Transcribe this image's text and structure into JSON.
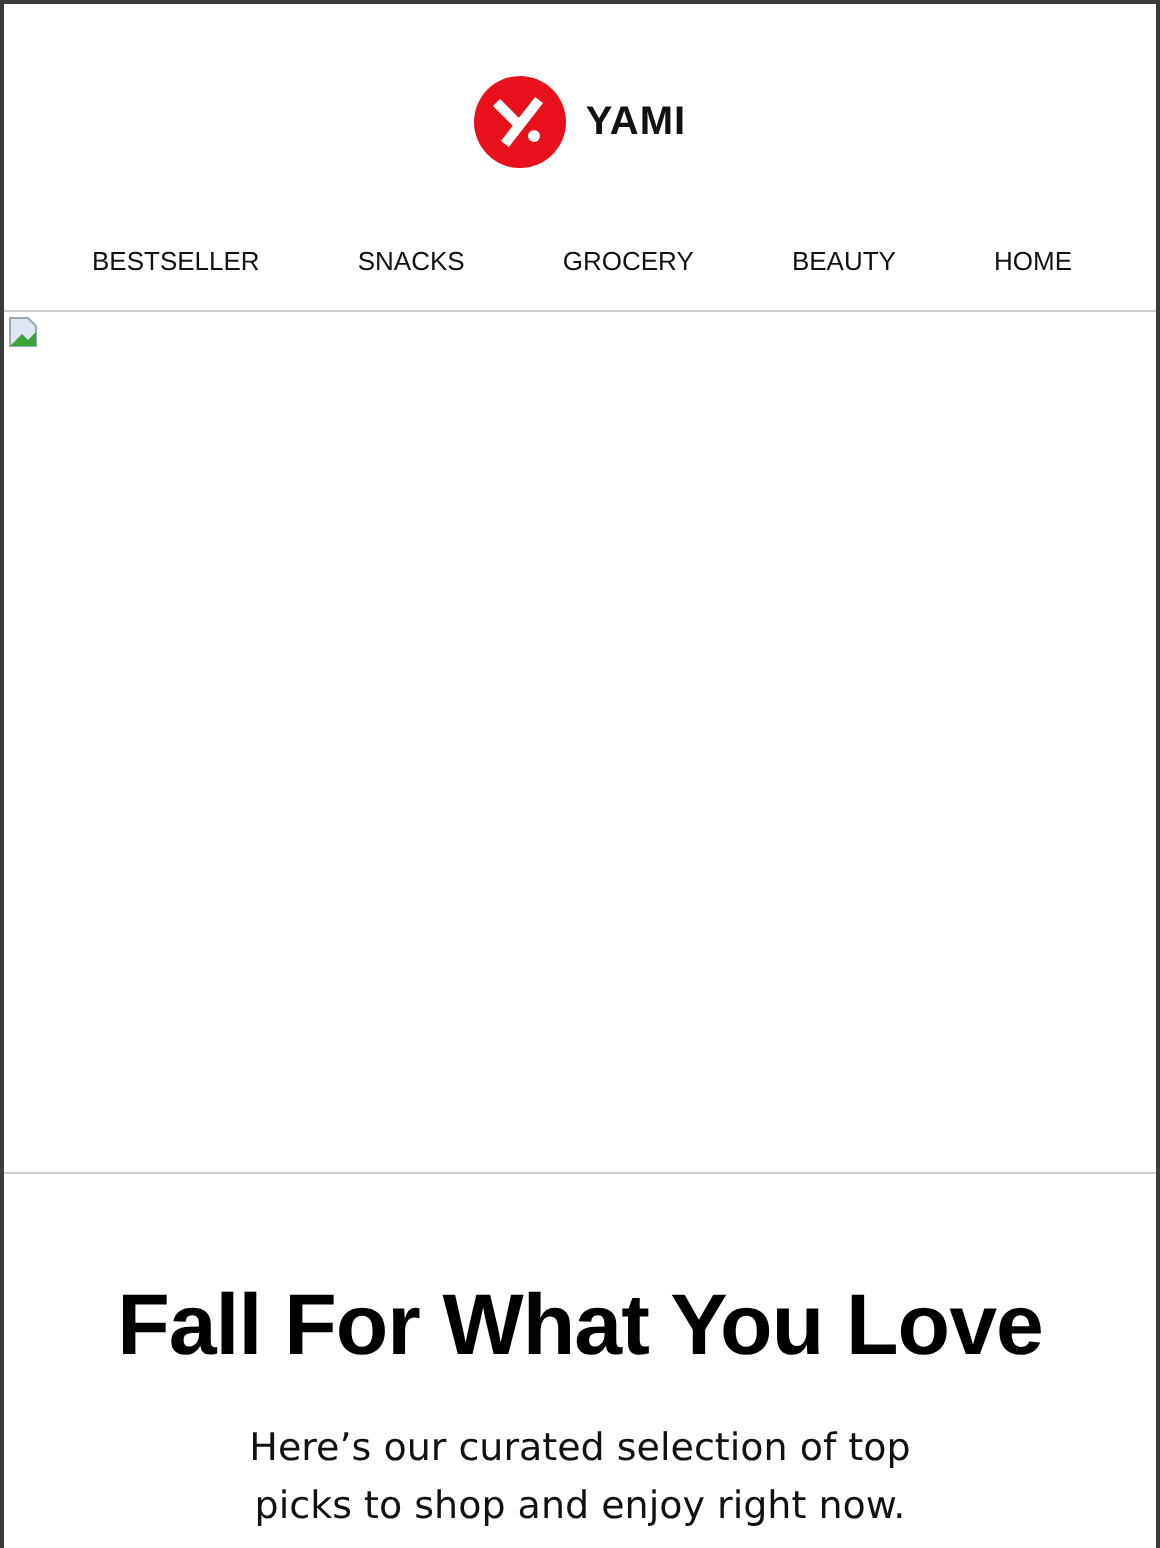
{
  "brand": {
    "name": "YAMI"
  },
  "nav": [
    {
      "label": "BESTSELLER"
    },
    {
      "label": "SNACKS"
    },
    {
      "label": "GROCERY"
    },
    {
      "label": "BEAUTY"
    },
    {
      "label": "HOME"
    }
  ],
  "hero": {
    "kind": "broken-image"
  },
  "headline": "Fall For What You Love",
  "intro": "Here’s our curated selection of top picks to shop and enjoy right now."
}
